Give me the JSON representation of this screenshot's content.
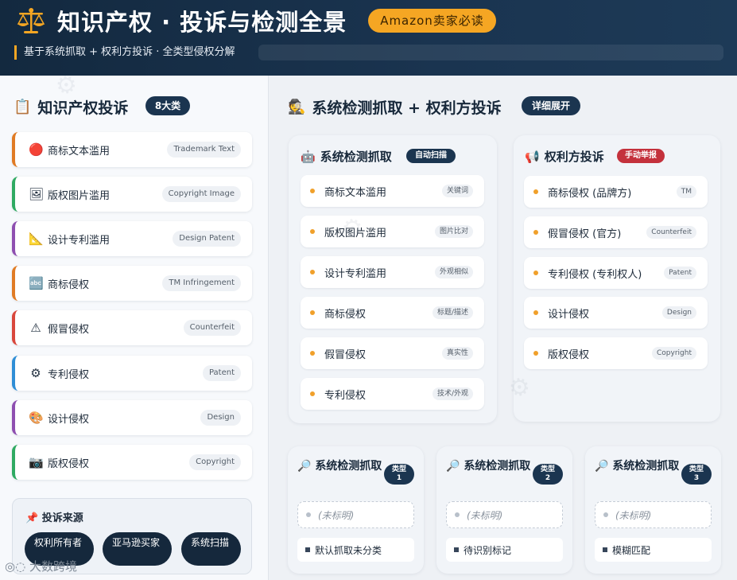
{
  "colors": {
    "header_bg": "#13293f",
    "accent_orange": "#f5a623",
    "dark_navy": "#1b3550",
    "manual_red": "#c4313c",
    "dot_orange": "#f0a02a"
  },
  "header": {
    "title": "知识产权 · 投诉与检测全景",
    "badge": "Amazon卖家必读",
    "subtitle": "基于系统抓取 + 权利方投诉 · 全类型侵权分解",
    "icon": "scales-icon"
  },
  "left": {
    "title": "知识产权投诉",
    "title_icon": "clipboard-icon",
    "count_badge": "8大类",
    "items": [
      {
        "label": "商标文本滥用",
        "tag": "Trademark Text",
        "icon": "red-circle-icon",
        "glyph": "🔴",
        "color": "#e07b24"
      },
      {
        "label": "版权图片滥用",
        "tag": "Copyright Image",
        "icon": "picture-icon",
        "glyph": "🖼",
        "color": "#2faa62"
      },
      {
        "label": "设计专利滥用",
        "tag": "Design Patent",
        "icon": "triangle-ruler-icon",
        "glyph": "📐",
        "color": "#8e4fb0"
      },
      {
        "label": "商标侵权",
        "tag": "TM Infringement",
        "icon": "tm-icon",
        "glyph": "🔤",
        "color": "#e07b24"
      },
      {
        "label": "假冒侵权",
        "tag": "Counterfeit",
        "icon": "warning-icon",
        "glyph": "⚠",
        "color": "#d9473c"
      },
      {
        "label": "专利侵权",
        "tag": "Patent",
        "icon": "gear-icon",
        "glyph": "⚙",
        "color": "#2f8ed6"
      },
      {
        "label": "设计侵权",
        "tag": "Design",
        "icon": "palette-icon",
        "glyph": "🎨",
        "color": "#8e4fb0"
      },
      {
        "label": "版权侵权",
        "tag": "Copyright",
        "icon": "camera-icon",
        "glyph": "📷",
        "color": "#2faa62"
      }
    ],
    "source": {
      "title": "投诉来源",
      "icon": "pin-icon",
      "chips": [
        "权利所有者",
        "亚马逊买家",
        "系统扫描"
      ]
    },
    "footer": "大数跨境"
  },
  "right": {
    "title": "系统检测抓取 + 权利方投诉",
    "title_icon": "detective-icon",
    "badge": "详细展开",
    "system_card": {
      "title": "系统检测抓取",
      "icon": "robot-icon",
      "badge": "自动扫描",
      "rows": [
        {
          "label": "商标文本滥用",
          "tag": "关键词"
        },
        {
          "label": "版权图片滥用",
          "tag": "图片比对"
        },
        {
          "label": "设计专利滥用",
          "tag": "外观相似"
        },
        {
          "label": "商标侵权",
          "tag": "标题/描述"
        },
        {
          "label": "假冒侵权",
          "tag": "真实性"
        },
        {
          "label": "专利侵权",
          "tag": "技术/外观"
        }
      ]
    },
    "rights_card": {
      "title": "权利方投诉",
      "icon": "megaphone-icon",
      "badge": "手动举报",
      "rows": [
        {
          "label": "商标侵权 (品牌方)",
          "tag": "TM"
        },
        {
          "label": "假冒侵权 (官方)",
          "tag": "Counterfeit"
        },
        {
          "label": "专利侵权 (专利权人)",
          "tag": "Patent"
        },
        {
          "label": "设计侵权",
          "tag": "Design"
        },
        {
          "label": "版权侵权",
          "tag": "Copyright"
        }
      ]
    },
    "type_cards": [
      {
        "title": "系统检测抓取",
        "badge_line1": "类型",
        "badge_line2": "1",
        "placeholder": "(未标明)",
        "note": "默认抓取未分类"
      },
      {
        "title": "系统检测抓取",
        "badge_line1": "类型",
        "badge_line2": "2",
        "placeholder": "(未标明)",
        "note": "待识别标记"
      },
      {
        "title": "系统检测抓取",
        "badge_line1": "类型",
        "badge_line2": "3",
        "placeholder": "(未标明)",
        "note": "模糊匹配"
      }
    ]
  }
}
